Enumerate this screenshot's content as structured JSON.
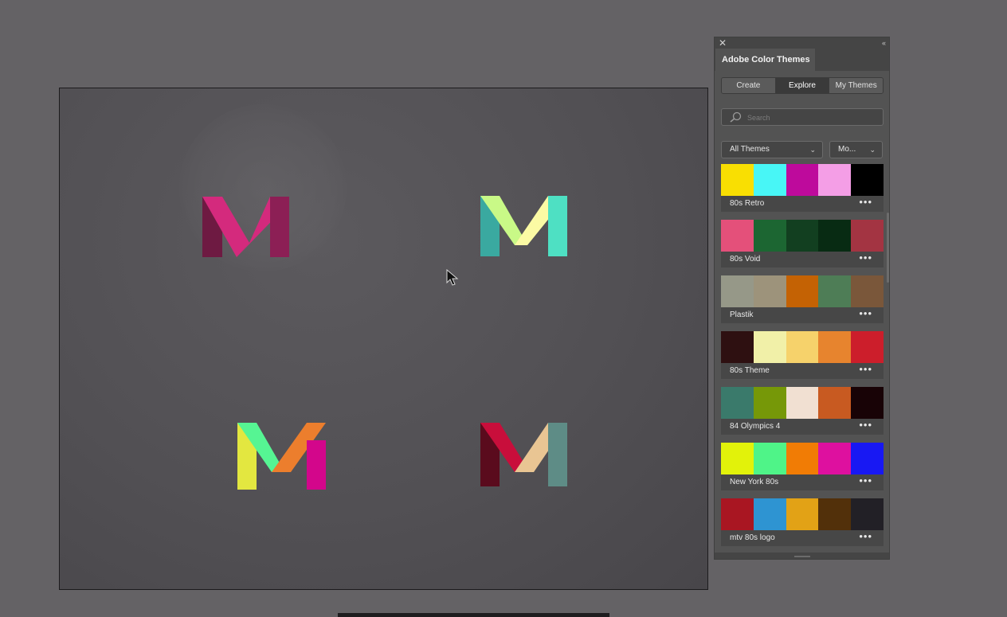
{
  "panel": {
    "title": "Adobe Color Themes",
    "close_glyph": "✕",
    "collapse_glyph": "‹‹",
    "tabs": [
      {
        "label": "Create",
        "selected": false
      },
      {
        "label": "Explore",
        "selected": true
      },
      {
        "label": "My Themes",
        "selected": false
      }
    ],
    "search_placeholder": "Search",
    "filter_value": "All Themes",
    "sort_value": "Mo...",
    "more_glyph": "•••",
    "themes": [
      {
        "name": "80s Retro",
        "colors": [
          "#F9DF02",
          "#48F6F6",
          "#BE0A9C",
          "#F49EE6",
          "#000000"
        ]
      },
      {
        "name": "80s Void",
        "colors": [
          "#E4507A",
          "#1C6632",
          "#123F20",
          "#082B13",
          "#A33442"
        ]
      },
      {
        "name": "Plastik",
        "colors": [
          "#969888",
          "#9D937B",
          "#C46204",
          "#4E7D56",
          "#7A573A"
        ]
      },
      {
        "name": "80s Theme",
        "colors": [
          "#2E1011",
          "#F1F0A8",
          "#F6D26B",
          "#E7842E",
          "#CC1E2B"
        ]
      },
      {
        "name": "84 Olympics 4",
        "colors": [
          "#3A7A6B",
          "#769808",
          "#F1E0D2",
          "#C85A21",
          "#180306"
        ]
      },
      {
        "name": "New York 80s",
        "colors": [
          "#E2F20A",
          "#4FF488",
          "#F17C05",
          "#DE109F",
          "#1818F3"
        ]
      },
      {
        "name": "mtv 80s logo",
        "colors": [
          "#A91622",
          "#2E94D2",
          "#E2A216",
          "#52300A",
          "#222026"
        ]
      }
    ]
  },
  "canvas": {
    "logos": [
      {
        "name": "M",
        "colors": [
          "#6E1A42",
          "#D42A7D",
          "#8C1F55"
        ]
      },
      {
        "name": "M",
        "colors": [
          "#3AA9A0",
          "#C9F987",
          "#FBFAA4",
          "#4EE0C3"
        ]
      },
      {
        "name": "M",
        "colors": [
          "#E3E740",
          "#56F593",
          "#EC7E2D",
          "#D3068B"
        ]
      },
      {
        "name": "M",
        "colors": [
          "#5A0B1D",
          "#C80E3B",
          "#E9C593",
          "#5E8C86"
        ]
      }
    ]
  }
}
